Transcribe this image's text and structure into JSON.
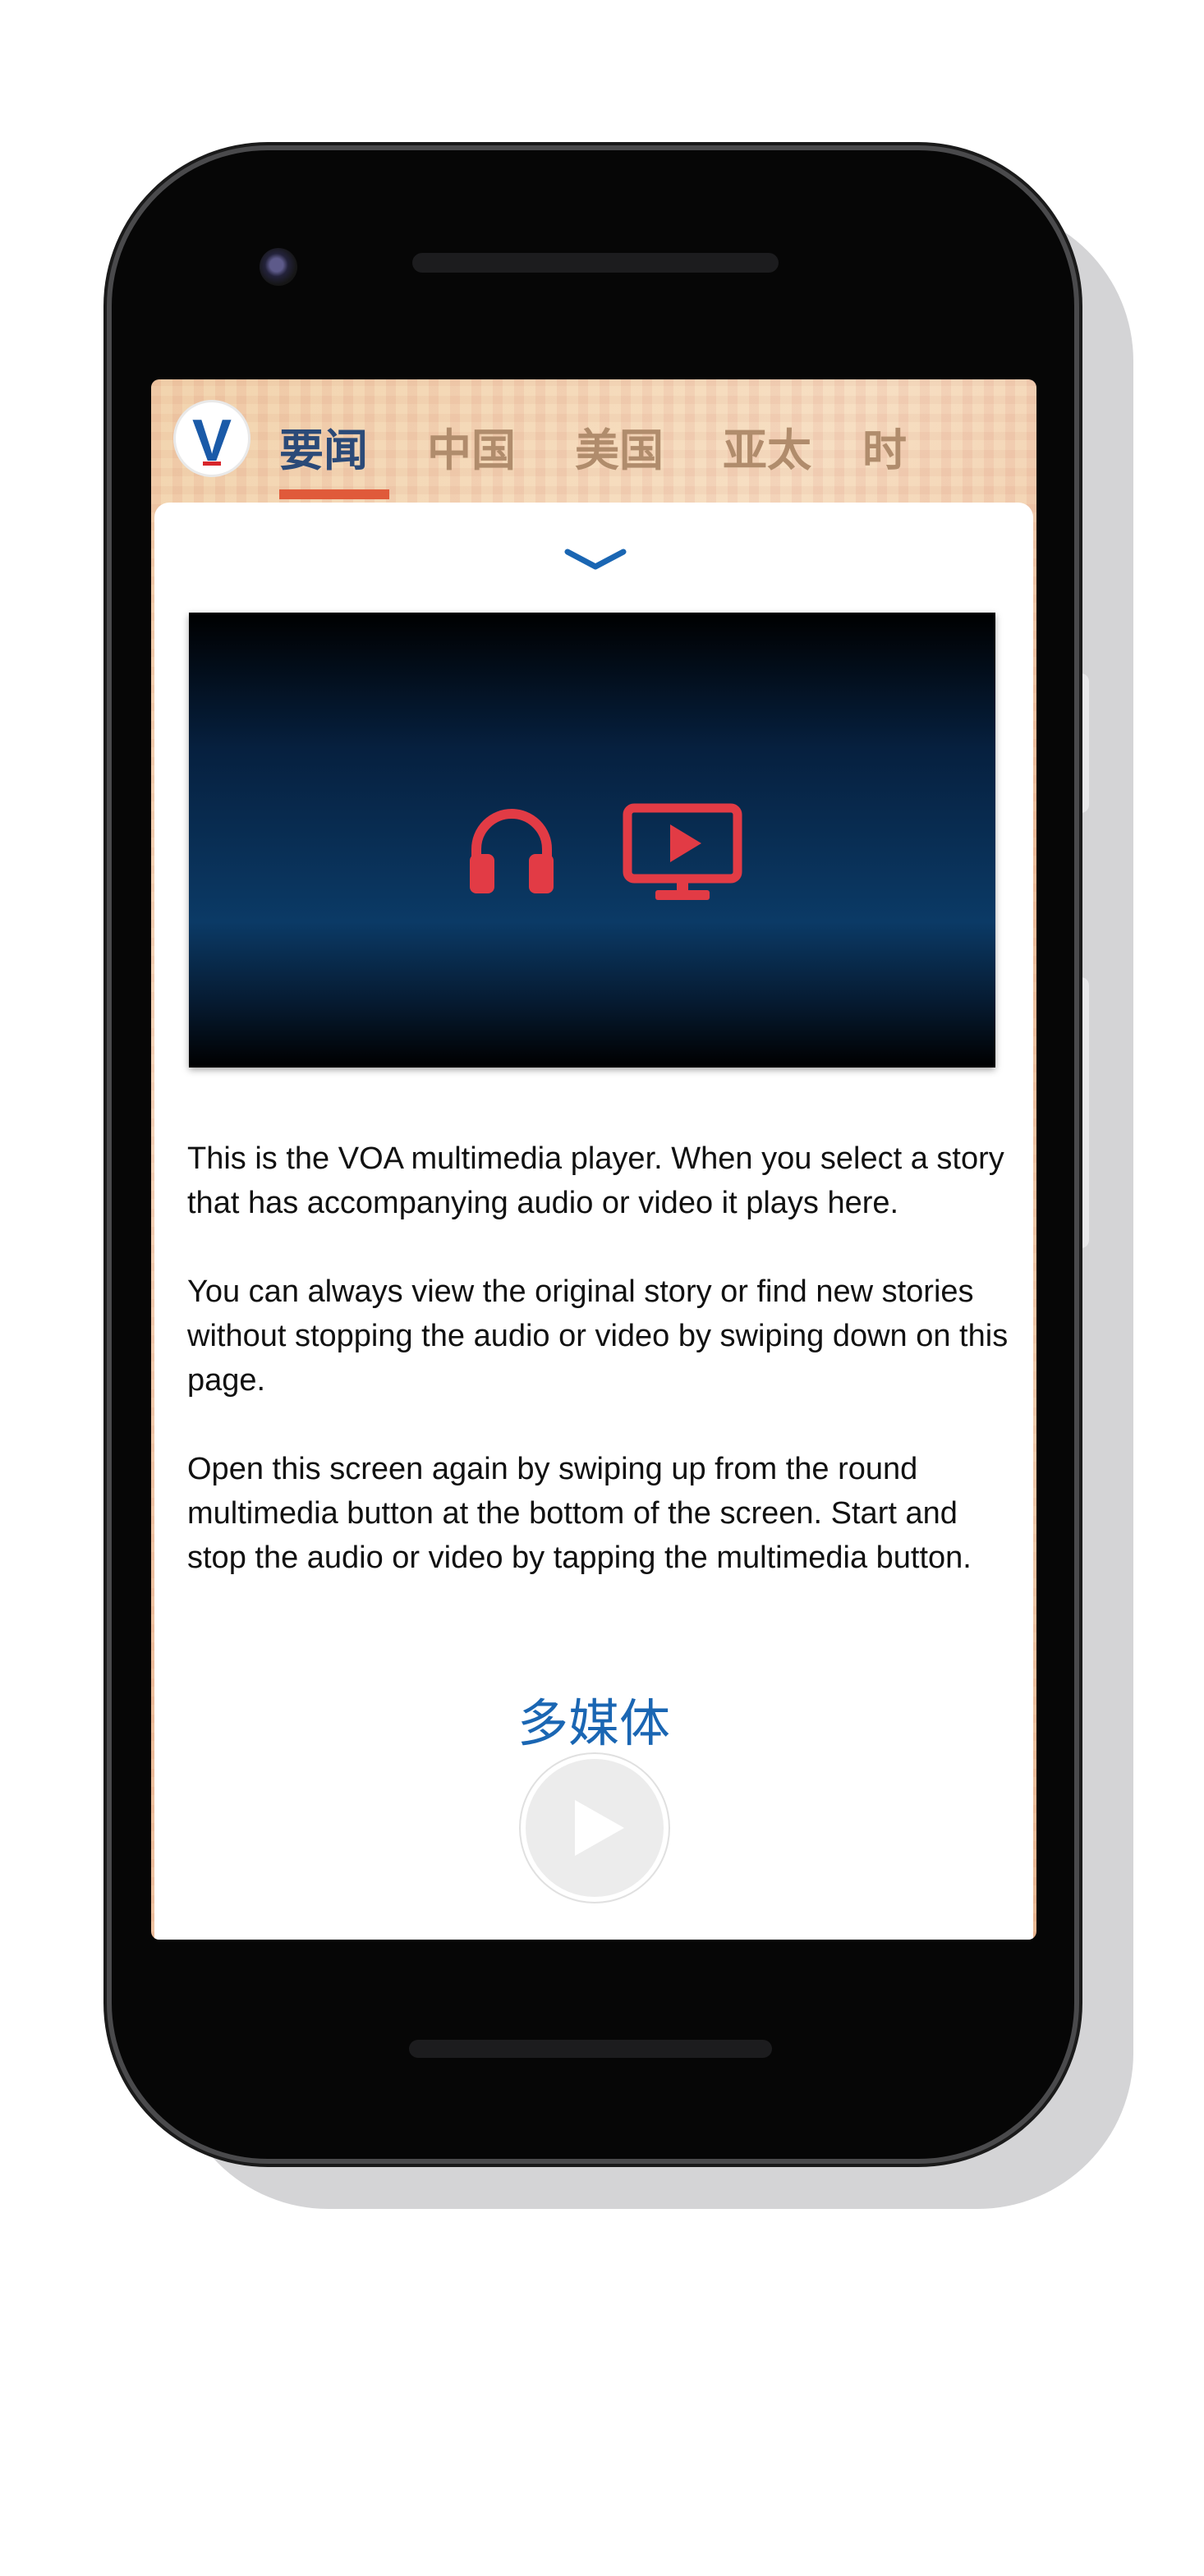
{
  "nav": {
    "tabs": [
      {
        "label": "要闻",
        "active": true
      },
      {
        "label": "中国",
        "active": false
      },
      {
        "label": "美国",
        "active": false
      },
      {
        "label": "亚太",
        "active": false
      },
      {
        "label": "时",
        "active": false
      }
    ]
  },
  "logo": {
    "letter": "V"
  },
  "player": {
    "icons": [
      "chevron-down-icon",
      "headphones-icon",
      "video-player-icon",
      "play-icon"
    ],
    "intro_paragraphs": [
      "This is the VOA multimedia player. When you select a story that has accompanying audio or video it plays here.",
      "You can always view the original story or find new stories without stopping the audio or video by swiping down on this page.",
      "Open this screen again by swiping up from the round multimedia button at the bottom of the screen. Start and stop the audio or video by tapping the multimedia button."
    ],
    "multimedia_label": "多媒体"
  },
  "colors": {
    "accent_blue": "#1a66b3",
    "icon_red": "#e23b45",
    "active_tab": "#2b4a78",
    "tab_underline": "#e05a3a"
  }
}
